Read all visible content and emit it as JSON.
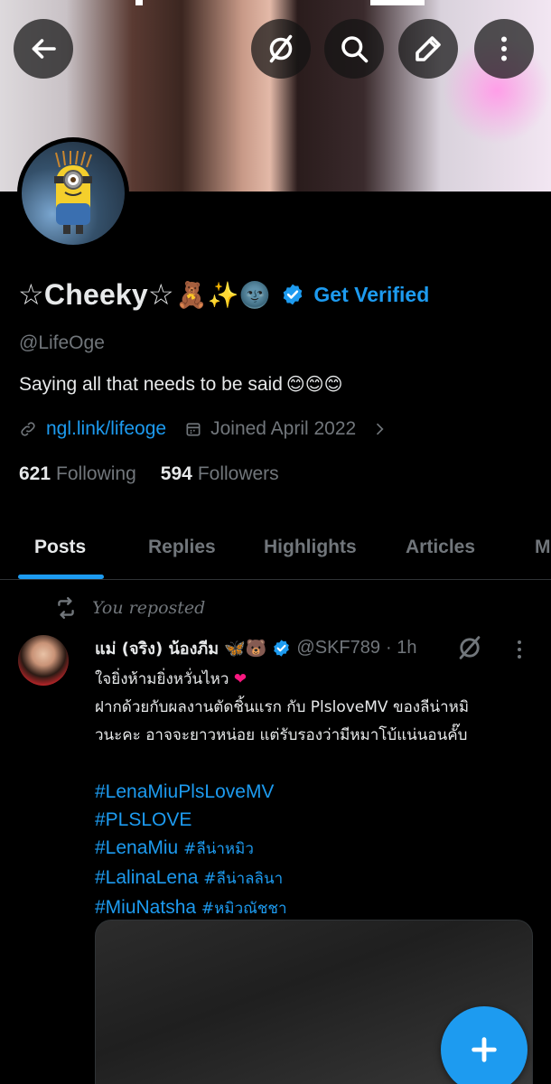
{
  "profile": {
    "display_name": "☆Cheeky☆",
    "name_emojis": "🧸✨🌚",
    "get_verified_label": "Get Verified",
    "handle": "@LifeOge",
    "bio": "Saying all that needs to be said",
    "bio_emojis": "😊😊😊",
    "link_text": "ngl.link/lifeoge",
    "joined_text": "Joined April 2022",
    "following_count": "621",
    "following_label": "Following",
    "followers_count": "594",
    "followers_label": "Followers"
  },
  "tabs": [
    {
      "label": "Posts",
      "active": true
    },
    {
      "label": "Replies",
      "active": false
    },
    {
      "label": "Highlights",
      "active": false
    },
    {
      "label": "Articles",
      "active": false
    },
    {
      "label": "M",
      "active": false
    }
  ],
  "post": {
    "repost_label": "You reposted",
    "author_name": "แม่ (จริง) น้องภีม",
    "author_emojis": "🦋🐻",
    "author_handle": "@SKF789",
    "time": "· 1h",
    "line1": "ใจยิ่งห้ามยิ่งหวั่นไหว",
    "line1_emoji": "❤",
    "line2": "ฝากด้วยกับผลงานตัดชิ้นแรก กับ PlsloveMV ของลีน่าหมิ",
    "line3": "วนะคะ อาจจะยาวหน่อย แต่รับรองว่ามีหมาโบ้แน่นอนคั๊บ",
    "hashtags": {
      "h1": "#LenaMiuPlsLoveMV",
      "h2": "#PLSLOVE",
      "h3a": "#LenaMiu",
      "h3b": "#ลีน่าหมิว",
      "h4a": "#LalinaLena",
      "h4b": "#ลีน่าลลินา",
      "h5a": "#MiuNatsha",
      "h5b": "#หมิวณัชชา"
    }
  },
  "icons": {
    "back": "back-arrow-icon",
    "grok": "grok-icon",
    "search": "search-icon",
    "edit": "edit-icon",
    "more": "more-vertical-icon",
    "link": "link-icon",
    "calendar": "calendar-icon",
    "repost": "repost-icon",
    "compose": "plus-icon"
  },
  "colors": {
    "accent": "#1d9bf0",
    "background": "#000000",
    "muted_text": "#71767b",
    "heart": "#f91880"
  }
}
